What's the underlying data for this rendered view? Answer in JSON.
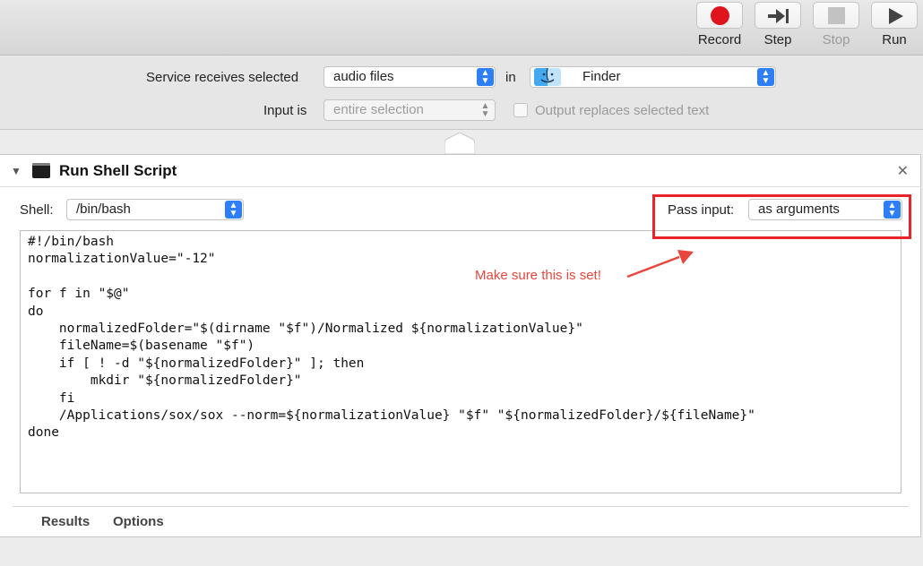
{
  "toolbar": {
    "record_label": "Record",
    "step_label": "Step",
    "stop_label": "Stop",
    "run_label": "Run"
  },
  "service": {
    "receives_label": "Service receives selected",
    "input_type": "audio files",
    "in_label": "in",
    "application": "Finder",
    "input_is_label": "Input is",
    "input_scope": "entire selection",
    "output_replaces_label": "Output replaces selected text"
  },
  "action": {
    "title": "Run Shell Script",
    "shell_label": "Shell:",
    "shell_value": "/bin/bash",
    "pass_input_label": "Pass input:",
    "pass_input_value": "as arguments",
    "code_lines": [
      "#!/bin/bash",
      "normalizationValue=\"-12\"",
      "",
      "for f in \"$@\"",
      "do",
      "    normalizedFolder=\"$(dirname \"$f\")/Normalized ${normalizationValue}\"",
      "    fileName=$(basename \"$f\")",
      "    if [ ! -d \"${normalizedFolder}\" ]; then",
      "        mkdir \"${normalizedFolder}\"",
      "    fi",
      "    /Applications/sox/sox --norm=${normalizationValue} \"$f\" \"${normalizedFolder}/${fileName}\"",
      "done"
    ],
    "annotation": "Make sure this is set!",
    "annotation_color": "#e8463c",
    "tabs": [
      "Results",
      "Options"
    ]
  },
  "colors": {
    "accent": "#2d7ef7",
    "record": "#e0141d",
    "highlight": "#e8232a"
  }
}
